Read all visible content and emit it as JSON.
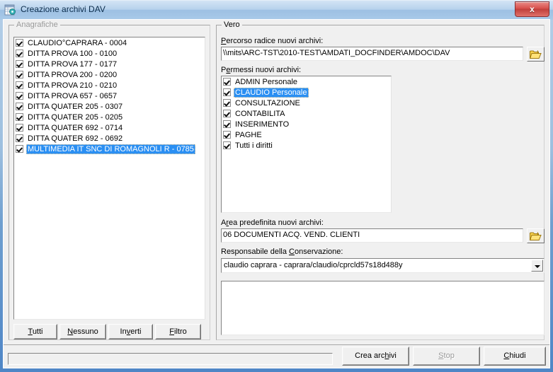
{
  "window": {
    "title": "Creazione archivi DAV",
    "icon": "archive-gear-icon",
    "close_label": "x",
    "accent_blue": "#2a8ff3",
    "title_bar_color": "#b7d2ec",
    "close_button_color": "#d8504c"
  },
  "left_panel": {
    "group_label": "Anagrafiche",
    "items": [
      {
        "label": "CLAUDIO°CAPRARA - 0004",
        "checked": true,
        "selected": false
      },
      {
        "label": "DITTA PROVA 100 - 0100",
        "checked": true,
        "selected": false
      },
      {
        "label": "DITTA PROVA 177 - 0177",
        "checked": true,
        "selected": false
      },
      {
        "label": "DITTA PROVA 200 - 0200",
        "checked": true,
        "selected": false
      },
      {
        "label": "DITTA PROVA 210 - 0210",
        "checked": true,
        "selected": false
      },
      {
        "label": "DITTA PROVA 657 - 0657",
        "checked": true,
        "selected": false
      },
      {
        "label": "DITTA QUATER 205 - 0307",
        "checked": true,
        "selected": false
      },
      {
        "label": "DITTA QUATER 205 - 0205",
        "checked": true,
        "selected": false
      },
      {
        "label": "DITTA QUATER 692 - 0714",
        "checked": true,
        "selected": false
      },
      {
        "label": "DITTA QUATER 692 - 0692",
        "checked": true,
        "selected": false
      },
      {
        "label": "MULTIMEDIA IT SNC DI ROMAGNOLI R - 0785",
        "checked": true,
        "selected": true
      }
    ],
    "buttons": [
      {
        "label": "Tutti",
        "accel": "T",
        "enabled": true
      },
      {
        "label": "Nessuno",
        "accel": "N",
        "enabled": true
      },
      {
        "label": "Inverti",
        "accel": "v",
        "enabled": true
      },
      {
        "label": "Filtro",
        "accel": "F",
        "enabled": true
      }
    ]
  },
  "right_panel": {
    "group_label": "Vero",
    "root_path": {
      "label": "Percorso radice nuovi archivi:",
      "accel": "P",
      "value": "\\\\mits\\ARC-TST\\2010-TEST\\AMDATI_DOCFINDER\\AMDOC\\DAV",
      "browse_icon": "folder-icon"
    },
    "permissions": {
      "label": "Permessi nuovi archivi:",
      "accel": "e",
      "items": [
        {
          "label": "ADMIN Personale",
          "checked": true,
          "selected": false
        },
        {
          "label": "CLAUDIO Personale",
          "checked": true,
          "selected": true
        },
        {
          "label": "CONSULTAZIONE",
          "checked": true,
          "selected": false
        },
        {
          "label": "CONTABILITA",
          "checked": true,
          "selected": false
        },
        {
          "label": "INSERIMENTO",
          "checked": true,
          "selected": false
        },
        {
          "label": "PAGHE",
          "checked": true,
          "selected": false
        },
        {
          "label": "Tutti i diritti",
          "checked": true,
          "selected": false
        }
      ]
    },
    "default_area": {
      "label": "Area predefinita nuovi archivi:",
      "accel": "r",
      "value": "06 DOCUMENTI ACQ. VEND. CLIENTI",
      "browse_icon": "folder-icon"
    },
    "responsible": {
      "label": "Responsabile della Conservazione:",
      "accel": "C",
      "value": "claudio caprara - caprara/claudio/cprcld57s18d488y"
    },
    "log": {
      "value": ""
    }
  },
  "footer": {
    "status_text": "",
    "buttons": [
      {
        "label": "Crea archivi",
        "accel": "h",
        "enabled": true
      },
      {
        "label": "Stop",
        "accel": "S",
        "enabled": false
      },
      {
        "label": "Chiudi",
        "accel": "C",
        "enabled": true
      }
    ]
  }
}
